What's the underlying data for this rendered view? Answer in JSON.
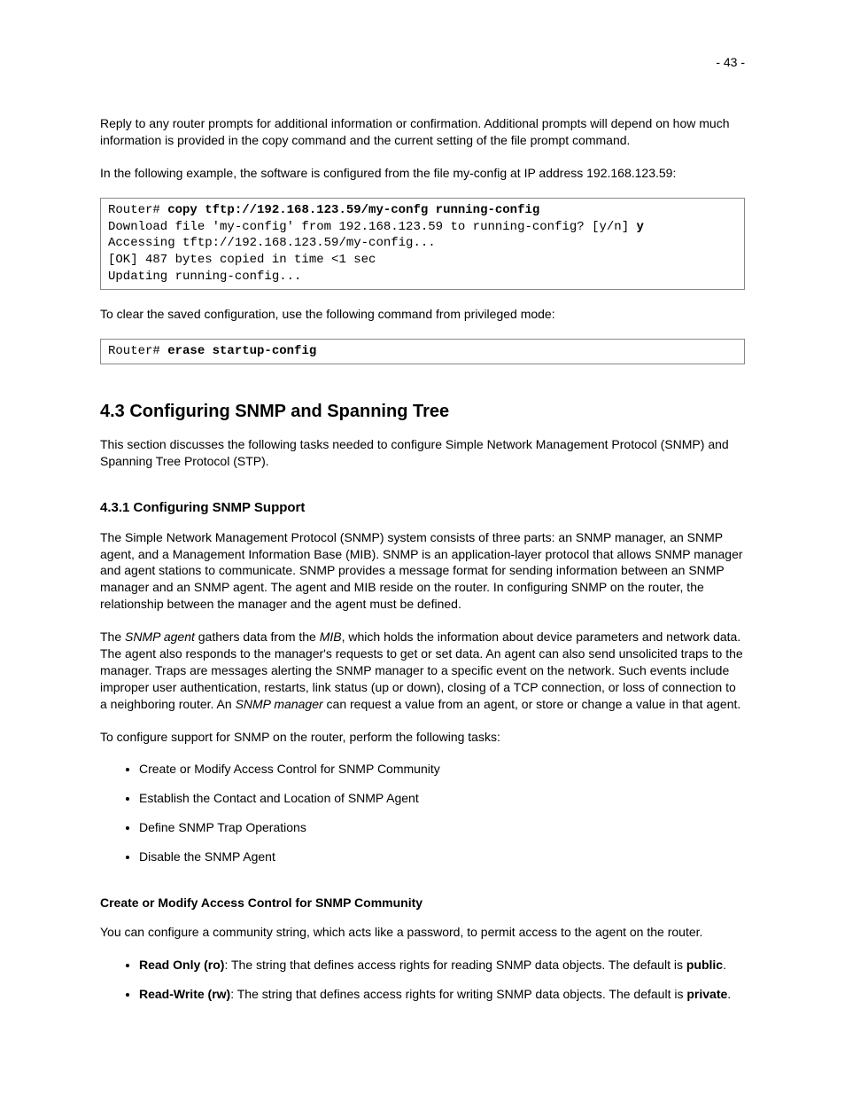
{
  "pageNumber": "- 43 -",
  "para1": "Reply to any router prompts for additional information or confirmation. Additional prompts will depend on how much information is provided in the copy command and the current setting of the file prompt command.",
  "para2": "In the following example, the software is configured from the file my-config at IP address 192.168.123.59:",
  "code1": {
    "l1_prompt": "Router# ",
    "l1_cmd": "copy tftp://192.168.123.59/my-confg running-config",
    "l2_a": "Download file 'my-config' from 192.168.123.59 to running-config? [y/n] ",
    "l2_b": "y",
    "l3": "Accessing tftp://192.168.123.59/my-config...",
    "l4": "[OK] 487 bytes copied in time <1 sec",
    "l5": "Updating running-config..."
  },
  "para3": "To clear the saved configuration, use the following command from privileged mode:",
  "code2": {
    "prompt": "Router# ",
    "cmd": "erase startup-config"
  },
  "section43": "4.3 Configuring SNMP and Spanning Tree",
  "para4": "This section discusses the following tasks needed to configure Simple Network Management Protocol (SNMP) and Spanning Tree Protocol (STP).",
  "sub431": "4.3.1 Configuring SNMP Support",
  "para5": "The Simple Network Management Protocol (SNMP) system consists of three parts: an SNMP manager, an SNMP agent, and a Management Information Base (MIB). SNMP is an application-layer protocol that allows SNMP manager and agent stations to communicate. SNMP provides a message format for sending information between an SNMP manager and an SNMP agent. The agent and MIB reside on the router. In configuring SNMP on the router, the relationship between the manager and the agent must be defined.",
  "para6_a": "The ",
  "para6_b": "SNMP agent",
  "para6_c": " gathers data from the ",
  "para6_d": "MIB",
  "para6_e": ", which holds the information about device parameters and network data. The agent also responds to the manager's requests to get or set data. An agent can also send unsolicited traps to the manager. Traps are messages alerting the SNMP manager to a specific event on the network. Such events include improper user authentication, restarts, link status (up or down), closing of a TCP connection, or loss of connection to a neighboring router. An ",
  "para6_f": "SNMP manager",
  "para6_g": " can request a value from an agent, or store or change a value in that agent.",
  "para7": "To configure support for SNMP on the router, perform the following tasks:",
  "tasks": [
    "Create or Modify Access Control for SNMP Community",
    "Establish the Contact and Location of SNMP Agent",
    "Define SNMP Trap Operations",
    "Disable the SNMP Agent"
  ],
  "subhead1": "Create or Modify Access Control for SNMP Community",
  "para8": "You can configure a community string, which acts like a password, to permit access to the agent on the router.",
  "rw": {
    "ro_label": "Read Only (ro)",
    "ro_text": ": The string that defines access rights for reading SNMP data objects. The default is ",
    "ro_def": "public",
    "rw_label": "Read-Write (rw)",
    "rw_text": ": The string that defines access rights for writing SNMP data objects. The default is ",
    "rw_def": "private"
  }
}
